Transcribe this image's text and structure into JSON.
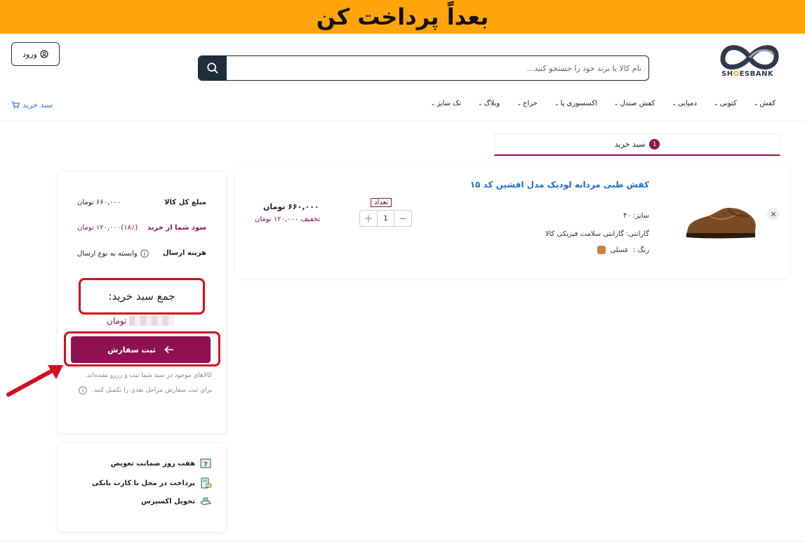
{
  "banner": {
    "text": "بعداً پرداخت کن"
  },
  "header": {
    "logo_text_pre": "SH",
    "logo_text_o": "O",
    "logo_text_post": "ESBANK",
    "search_placeholder": "نام کالا یا برند خود را جستجو کنید...",
    "login_label": "ورود"
  },
  "nav": {
    "items": [
      {
        "label": "کفش",
        "chevron": true
      },
      {
        "label": "کتونی",
        "chevron": true
      },
      {
        "label": "دمپایی",
        "chevron": true
      },
      {
        "label": "کفش صندل",
        "chevron": true
      },
      {
        "label": "اکسسوری پا",
        "chevron": true
      },
      {
        "label": "حراج",
        "chevron": true
      },
      {
        "label": "وبلاگ",
        "chevron": true
      },
      {
        "label": "تک سایز",
        "chevron": true
      }
    ],
    "cart_label": "سبد خرید"
  },
  "cart_tab": {
    "label": "سبد خرید",
    "count": "1"
  },
  "product": {
    "title": "کفش طبی مردانه لودیک مدل افشین کد ۱۵",
    "size": "سایز: ۴۰",
    "warranty": "گارانتی: گارانتی سلامت فیزیکی کالا",
    "color_label": "رنگ :",
    "color_value": "عسلی",
    "color_hex": "#c6863f",
    "qty_label": "تعداد",
    "qty": "1",
    "price": "۶۶۰,۰۰۰ تومان",
    "discount": "تخفیف ۱۲۰,۰۰۰ تومان"
  },
  "summary": {
    "total_label": "مبلغ کل کالا",
    "total_value": "۶۶۰,۰۰۰ تومان",
    "profit_label": "سود شما از خرید",
    "profit_value": "(۱۸٪)۱۲۰,۰۰۰ تومان",
    "shipping_label": "هزینه ارسال",
    "shipping_value": "وابسته به نوع ارسال",
    "grand_label": "جمع سبد خرید:",
    "grand_currency": "تومان",
    "submit_label": "ثبت سفارش",
    "note": "کالاهای موجود در سبد شما ثبت و رزرو نشده‌اند، برای ثبت سفارش مراحل بعدی را تکمیل کنید."
  },
  "guarantees": [
    {
      "label": "هفت روز ضمانت تعویض",
      "icon": "box-7-icon"
    },
    {
      "label": "پرداخت در محل با کارت بانکی",
      "icon": "card-reader-icon"
    },
    {
      "label": "تحویل اکسپرس",
      "icon": "express-delivery-icon"
    }
  ],
  "colors": {
    "accent": "#8e1250",
    "banner": "#ffa50a",
    "highlight": "#d40d1f",
    "link": "#1e6fc8"
  }
}
